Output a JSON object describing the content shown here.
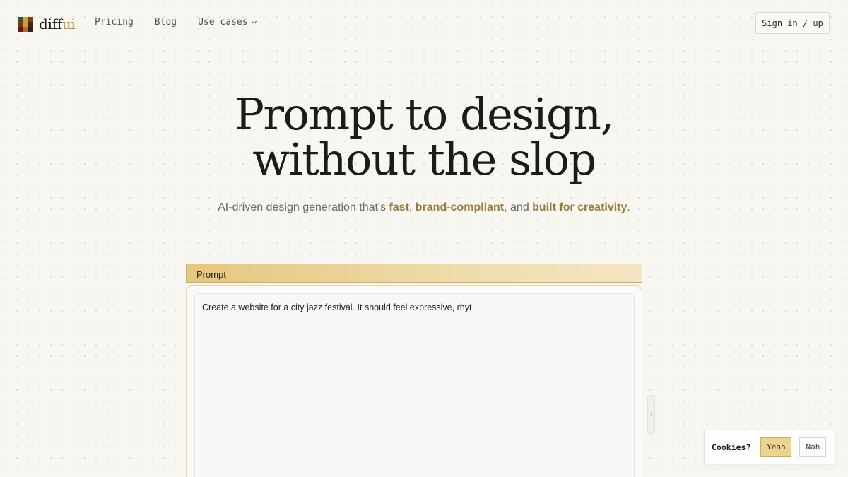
{
  "brand": {
    "name_prefix": "diff",
    "name_suffix": "ui",
    "logo_colors": [
      "#2f5a2e",
      "#c9a23a",
      "#7a3a1c",
      "#8e2a1a",
      "#d49a2a",
      "#3b2a18",
      "#5a1e12",
      "#b8662a",
      "#2a2416"
    ]
  },
  "nav": {
    "items": [
      {
        "label": "Pricing"
      },
      {
        "label": "Blog"
      },
      {
        "label": "Use cases",
        "has_dropdown": true
      }
    ],
    "signin_label": "Sign in / up"
  },
  "hero": {
    "title_line1": "Prompt to design,",
    "title_line2": "without the slop",
    "subtitle_prefix": "AI-driven design generation that's ",
    "subtitle_em1": "fast",
    "subtitle_sep1": ", ",
    "subtitle_em2": "brand-compliant",
    "subtitle_sep2": ", and ",
    "subtitle_em3": "built for creativity",
    "subtitle_end": "."
  },
  "prompt": {
    "header_label": "Prompt",
    "value": "Create a website for a city jazz festival. It should feel expressive, rhyt",
    "handle_glyph": "›"
  },
  "cookie": {
    "label": "Cookies?",
    "accept_label": "Yeah",
    "decline_label": "Nah"
  },
  "colors": {
    "accent": "#b68a35",
    "highlight_text": "#9a7b3f",
    "prompt_header_bg": "#e5c77d",
    "background": "#f8f6f1"
  }
}
